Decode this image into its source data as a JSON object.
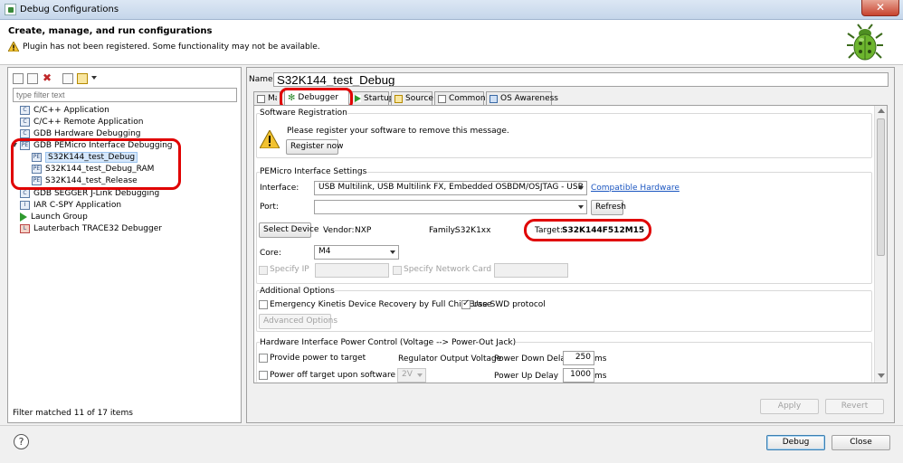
{
  "window": {
    "title": "Debug Configurations",
    "close_glyph": "✕"
  },
  "header": {
    "title": "Create, manage, and run configurations",
    "warning": "Plugin has not been registered. Some functionality may not be available."
  },
  "left": {
    "filter_placeholder": "type filter text",
    "tree": [
      {
        "label": "C/C++ Application",
        "icon": "c-app-icon"
      },
      {
        "label": "C/C++ Remote Application",
        "icon": "c-app-icon"
      },
      {
        "label": "GDB Hardware Debugging",
        "icon": "c-app-icon"
      },
      {
        "label": "GDB PEMicro Interface Debugging",
        "icon": "pemicro-icon"
      },
      {
        "label": "S32K144_test_Debug",
        "icon": "pemicro-icon",
        "selected": true
      },
      {
        "label": "S32K144_test_Debug_RAM",
        "icon": "pemicro-icon"
      },
      {
        "label": "S32K144_test_Release",
        "icon": "pemicro-icon"
      },
      {
        "label": "GDB SEGGER J-Link Debugging",
        "icon": "c-app-icon"
      },
      {
        "label": "IAR C-SPY Application",
        "icon": "iar-icon"
      },
      {
        "label": "Launch Group",
        "icon": "launch-icon"
      },
      {
        "label": "Lauterbach TRACE32 Debugger",
        "icon": "lauterbach-icon"
      }
    ],
    "status": "Filter matched 11 of 17 items"
  },
  "right": {
    "name_label": "Name:",
    "name_value": "S32K144_test_Debug",
    "tabs": [
      "Main",
      "Debugger",
      "Startup",
      "Source",
      "Common",
      "OS Awareness"
    ],
    "software_registration": {
      "title": "Software Registration",
      "message": "Please register your software to remove this message.",
      "button": "Register now"
    },
    "pemicro": {
      "title": "PEMicro Interface Settings",
      "interface_label": "Interface:",
      "interface_value": "USB Multilink, USB Multilink FX, Embedded OSBDM/OSJTAG - USB Port",
      "compatible_hardware": "Compatible Hardware",
      "port_label": "Port:",
      "port_value": "",
      "refresh": "Refresh",
      "select_device": "Select Device",
      "vendor_label": "Vendor:",
      "vendor_value": "NXP",
      "family_label": "Family:",
      "family_value": "S32K1xx",
      "target_label": "Target:",
      "target_value": "S32K144F512M15",
      "core_label": "Core:",
      "core_value": "M4",
      "specify_ip": "Specify IP",
      "specify_network_card_ip": "Specify Network Card IP"
    },
    "additional": {
      "title": "Additional Options",
      "emergency_recovery": "Emergency Kinetis Device Recovery by Full Chip Erase",
      "use_swd": "Use SWD protocol",
      "advanced_options": "Advanced Options"
    },
    "power": {
      "title": "Hardware Interface Power Control (Voltage --> Power-Out Jack)",
      "provide_power": "Provide power to target",
      "power_off": "Power off target upon software exit",
      "voltage_value": "2V",
      "regulator_label": "Regulator Output Voltage",
      "power_down_label": "Power Down Delay",
      "power_down_value": "250",
      "power_up_label": "Power Up Delay",
      "power_up_value": "1000",
      "unit": "ms"
    },
    "apply": "Apply",
    "revert": "Revert"
  },
  "footer": {
    "help_glyph": "?",
    "debug": "Debug",
    "close": "Close"
  },
  "colors": {
    "annotation_red": "#e00000",
    "link": "#1a55c0",
    "selection": "#d5e7fb"
  }
}
